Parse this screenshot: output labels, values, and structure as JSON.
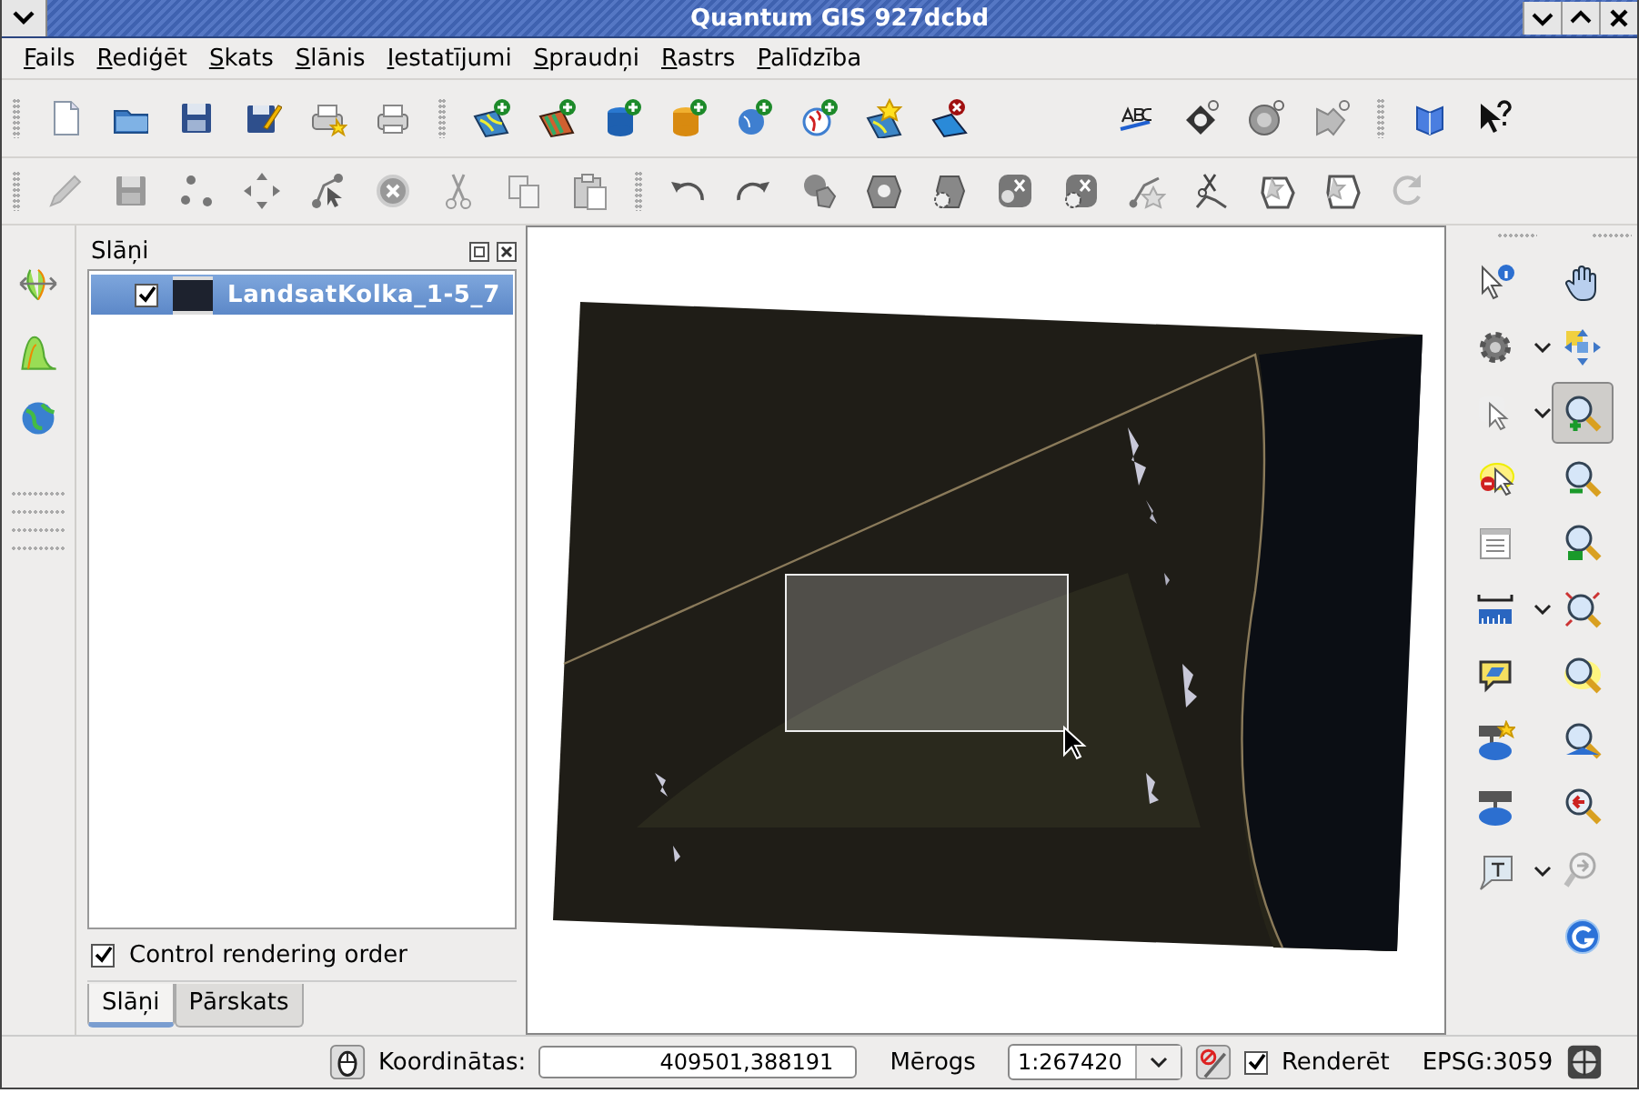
{
  "window": {
    "title": "Quantum GIS 927dcbd"
  },
  "menu": [
    {
      "label": "Fails"
    },
    {
      "label": "Rediģēt"
    },
    {
      "label": "Skats"
    },
    {
      "label": "Slānis"
    },
    {
      "label": "Iestatījumi"
    },
    {
      "label": "Spraudņi"
    },
    {
      "label": "Rastrs"
    },
    {
      "label": "Palīdzība"
    }
  ],
  "layers_panel": {
    "title": "Slāņi",
    "layers": [
      {
        "name": "LandsatKolka_1-5_7",
        "checked": true,
        "selected": true
      }
    ],
    "control_rendering_order": {
      "label": "Control rendering order",
      "checked": true
    },
    "tabs": [
      {
        "label": "Slāņi",
        "selected": true
      },
      {
        "label": "Pārskats",
        "selected": false
      }
    ]
  },
  "map_tools": [
    {
      "selected": false
    },
    {
      "selected": false
    },
    {
      "selected": false
    },
    {
      "selected": false
    },
    {
      "selected": false
    },
    {
      "selected": true
    },
    {
      "selected": false
    },
    {
      "selected": false
    },
    {
      "selected": false
    },
    {
      "selected": false
    },
    {
      "selected": false
    },
    {
      "selected": false
    },
    {
      "selected": false
    },
    {
      "selected": false
    },
    {
      "selected": false
    },
    {
      "selected": false
    },
    {
      "selected": false
    },
    {
      "selected": false
    },
    {
      "selected": false
    },
    {
      "selected": false
    },
    {
      "selected": false
    }
  ],
  "status_bar": {
    "coordinates_label": "Koordinātas:",
    "coordinates_value": "409501,388191",
    "scale_label": "Mērogs",
    "scale_value": "1:267420",
    "render": {
      "label": "Renderēt",
      "checked": true
    },
    "crs": "EPSG:3059"
  }
}
